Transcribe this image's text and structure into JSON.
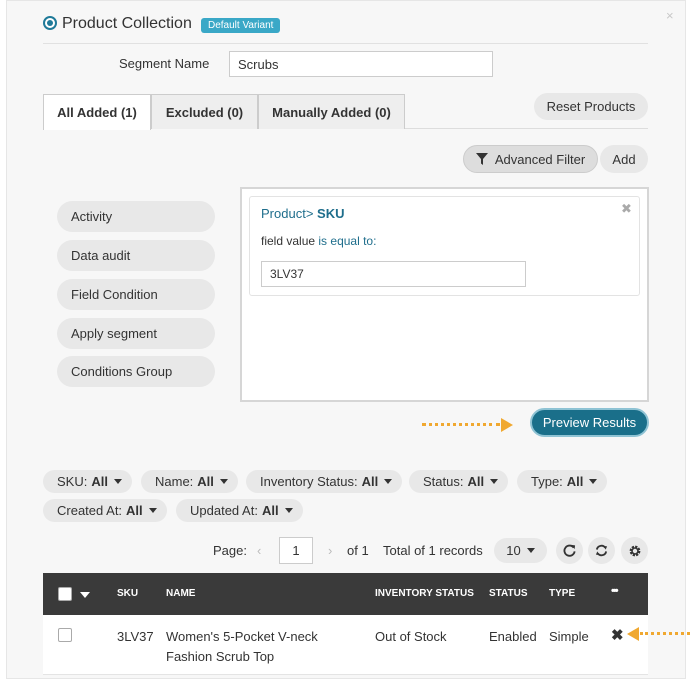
{
  "header": {
    "title": "Product Collection",
    "badge": "Default Variant",
    "close_icon": "×"
  },
  "segment": {
    "label": "Segment Name",
    "value": "Scrubs"
  },
  "tabs": [
    {
      "label": "All Added (1)",
      "active": true
    },
    {
      "label": "Excluded (0)",
      "active": false
    },
    {
      "label": "Manually Added (0)",
      "active": false
    }
  ],
  "buttons": {
    "reset": "Reset Products",
    "advanced_filter": "Advanced Filter",
    "add": "Add",
    "preview": "Preview Results"
  },
  "sidebar": {
    "items": [
      "Activity",
      "Data audit",
      "Field Condition",
      "Apply segment",
      "Conditions Group"
    ]
  },
  "filter": {
    "path": "Product",
    "separator": ">",
    "field": "SKU",
    "condition_prefix": "field value",
    "condition_op": "is equal to:",
    "value": "3LV37"
  },
  "chips": [
    {
      "label": "SKU:",
      "value": "All"
    },
    {
      "label": "Name:",
      "value": "All"
    },
    {
      "label": "Inventory Status:",
      "value": "All"
    },
    {
      "label": "Status:",
      "value": "All"
    },
    {
      "label": "Type:",
      "value": "All"
    },
    {
      "label": "Created At:",
      "value": "All"
    },
    {
      "label": "Updated At:",
      "value": "All"
    }
  ],
  "pager": {
    "label": "Page:",
    "current": "1",
    "of": "of 1",
    "total": "Total of 1 records",
    "per_page": "10"
  },
  "table": {
    "columns": [
      "SKU",
      "NAME",
      "INVENTORY STATUS",
      "STATUS",
      "TYPE",
      "•••"
    ],
    "rows": [
      {
        "sku": "3LV37",
        "name_line1": "Women's 5-Pocket V-neck",
        "name_line2": "Fashion Scrub Top",
        "inventory_status": "Out of Stock",
        "status": "Enabled",
        "type": "Simple"
      }
    ]
  },
  "colors": {
    "accent": "#1a6f8a",
    "badge": "#3aa8c7",
    "annotation_arrow": "#f0a830",
    "table_header": "#3a3a3a"
  }
}
